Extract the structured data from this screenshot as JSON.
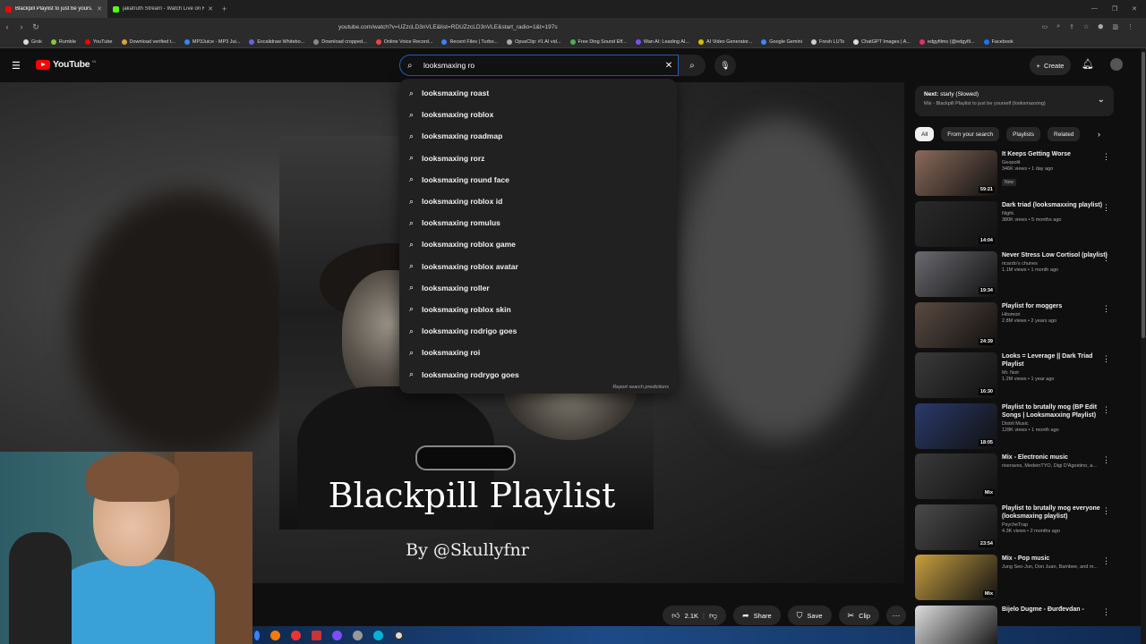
{
  "browser": {
    "tabs": [
      {
        "title": "Blackpill Playlist to just be yours...",
        "color": "#ff0000",
        "active": true
      },
      {
        "title": "jakatruth Stream - Watch Live on Kick",
        "color": "#53fc18",
        "active": false
      }
    ],
    "url": "youtube.com/watch?v=UZzcLD3nVLE&list=RDUZzcLD3nVLE&start_radio=1&t=197s",
    "bookmarks": [
      {
        "label": "Grok",
        "color": "#ddd"
      },
      {
        "label": "Rumble",
        "color": "#85c742"
      },
      {
        "label": "YouTube",
        "color": "#ff0000"
      },
      {
        "label": "Download verified t...",
        "color": "#e0a040"
      },
      {
        "label": "MP3Juice - MP3 Jui...",
        "color": "#3b82f6"
      },
      {
        "label": "Excalidraw Whitebo...",
        "color": "#6965db"
      },
      {
        "label": "Download cropped...",
        "color": "#888"
      },
      {
        "label": "Online Voice Record...",
        "color": "#e44"
      },
      {
        "label": "Recent Files | Turbo...",
        "color": "#3b82f6"
      },
      {
        "label": "OpusClip: #1 AI vid...",
        "color": "#aaa"
      },
      {
        "label": "Free Ding Sound Eff...",
        "color": "#4caf50"
      },
      {
        "label": "Wan AI: Leading AI...",
        "color": "#7c4dff"
      },
      {
        "label": "AI Video Generator...",
        "color": "#d4c000"
      },
      {
        "label": "Google Gemini",
        "color": "#4285f4"
      },
      {
        "label": "Fresh LUTs",
        "color": "#ccc"
      },
      {
        "label": "ChatGPT Images | A...",
        "color": "#ddd"
      },
      {
        "label": "edgyfilms (@edgyfil...",
        "color": "#e1306c"
      },
      {
        "label": "Facebook",
        "color": "#1877f2"
      }
    ]
  },
  "youtube": {
    "logo_text": "YouTube",
    "logo_region": "IN",
    "search": {
      "query": "looksmaxing ro"
    },
    "create_label": "Create",
    "suggestions": [
      "looksmaxing roast",
      "looksmaxing roblox",
      "looksmaxing roadmap",
      "looksmaxing rorz",
      "looksmaxing round face",
      "looksmaxing roblox id",
      "looksmaxing romulus",
      "looksmaxing roblox game",
      "looksmaxing roblox avatar",
      "looksmaxing roller",
      "looksmaxing roblox skin",
      "looksmaxing rodrigo goes",
      "looksmaxing roi",
      "looksmaxing rodrygo goes"
    ],
    "report_label": "Report search predictions"
  },
  "video": {
    "overlay_title": "Blackpill Playlist",
    "overlay_by": "By @Skullyfnr",
    "likes": "2.1K",
    "share_label": "Share",
    "save_label": "Save",
    "clip_label": "Clip"
  },
  "sidebar": {
    "next_label": "Next:",
    "next_title": "starly (Slowed)",
    "mix_subtitle": "Mix - Blackpill Playlist to just be yourself (looksmaxxing)",
    "chips": [
      "All",
      "From your search",
      "Playlists",
      "Related"
    ],
    "videos": [
      {
        "title": "It Keeps Getting Worse",
        "channel": "Geopolit",
        "stats": "346K views • 1 day ago",
        "badge": "New",
        "duration": "59:21",
        "thumb": "#8a6a5a"
      },
      {
        "title": "Dark triad (looksmaxxing playlist)",
        "channel": "Night.",
        "stats": "380K views • 5 months ago",
        "badge": "",
        "duration": "14:04",
        "thumb": "#2a2a2a"
      },
      {
        "title": "Never Stress Low Cortisol (playlist)",
        "channel": "ricardo's chunes",
        "stats": "1.1M views • 1 month ago",
        "badge": "",
        "duration": "19:34",
        "thumb": "#6a6a70"
      },
      {
        "title": "Playlist for moggers",
        "channel": "Hitomori",
        "stats": "2.8M views • 2 years ago",
        "badge": "",
        "duration": "24:39",
        "thumb": "#5a4a40"
      },
      {
        "title": "Looks = Leverage || Dark Triad Playlist",
        "channel": "Mr. Noir",
        "stats": "1.2M views • 1 year ago",
        "badge": "",
        "duration": "16:30",
        "thumb": "#3a3a3a"
      },
      {
        "title": "Playlist to brutally mog (BP Edit Songs | Looksmaxxing Playlist)",
        "channel": "Distril Music",
        "stats": "128K views • 1 month ago",
        "badge": "",
        "duration": "18:05",
        "thumb": "#2a3a6a"
      },
      {
        "title": "Mix - Electronic music",
        "channel": "riseraves, MedeinTYO, Digi D'Agostino, a...",
        "stats": "",
        "badge": "",
        "duration": "Mix",
        "thumb": "#3a3a3a"
      },
      {
        "title": "Playlist to brutally mog everyone (looksmaxing playlist)",
        "channel": "PsycheTrap",
        "stats": "4.3K views • 2 months ago",
        "badge": "",
        "duration": "23:54",
        "thumb": "#4a4a4a"
      },
      {
        "title": "Mix - Pop music",
        "channel": "Jung Seo-Jun, Don Juan, Bambee, and m...",
        "stats": "",
        "badge": "",
        "duration": "Mix",
        "thumb": "#c8a040"
      },
      {
        "title": "Bijelo Dugme - Đurđevdan -",
        "channel": "",
        "stats": "",
        "badge": "",
        "duration": "",
        "thumb": "#ddd"
      }
    ]
  }
}
